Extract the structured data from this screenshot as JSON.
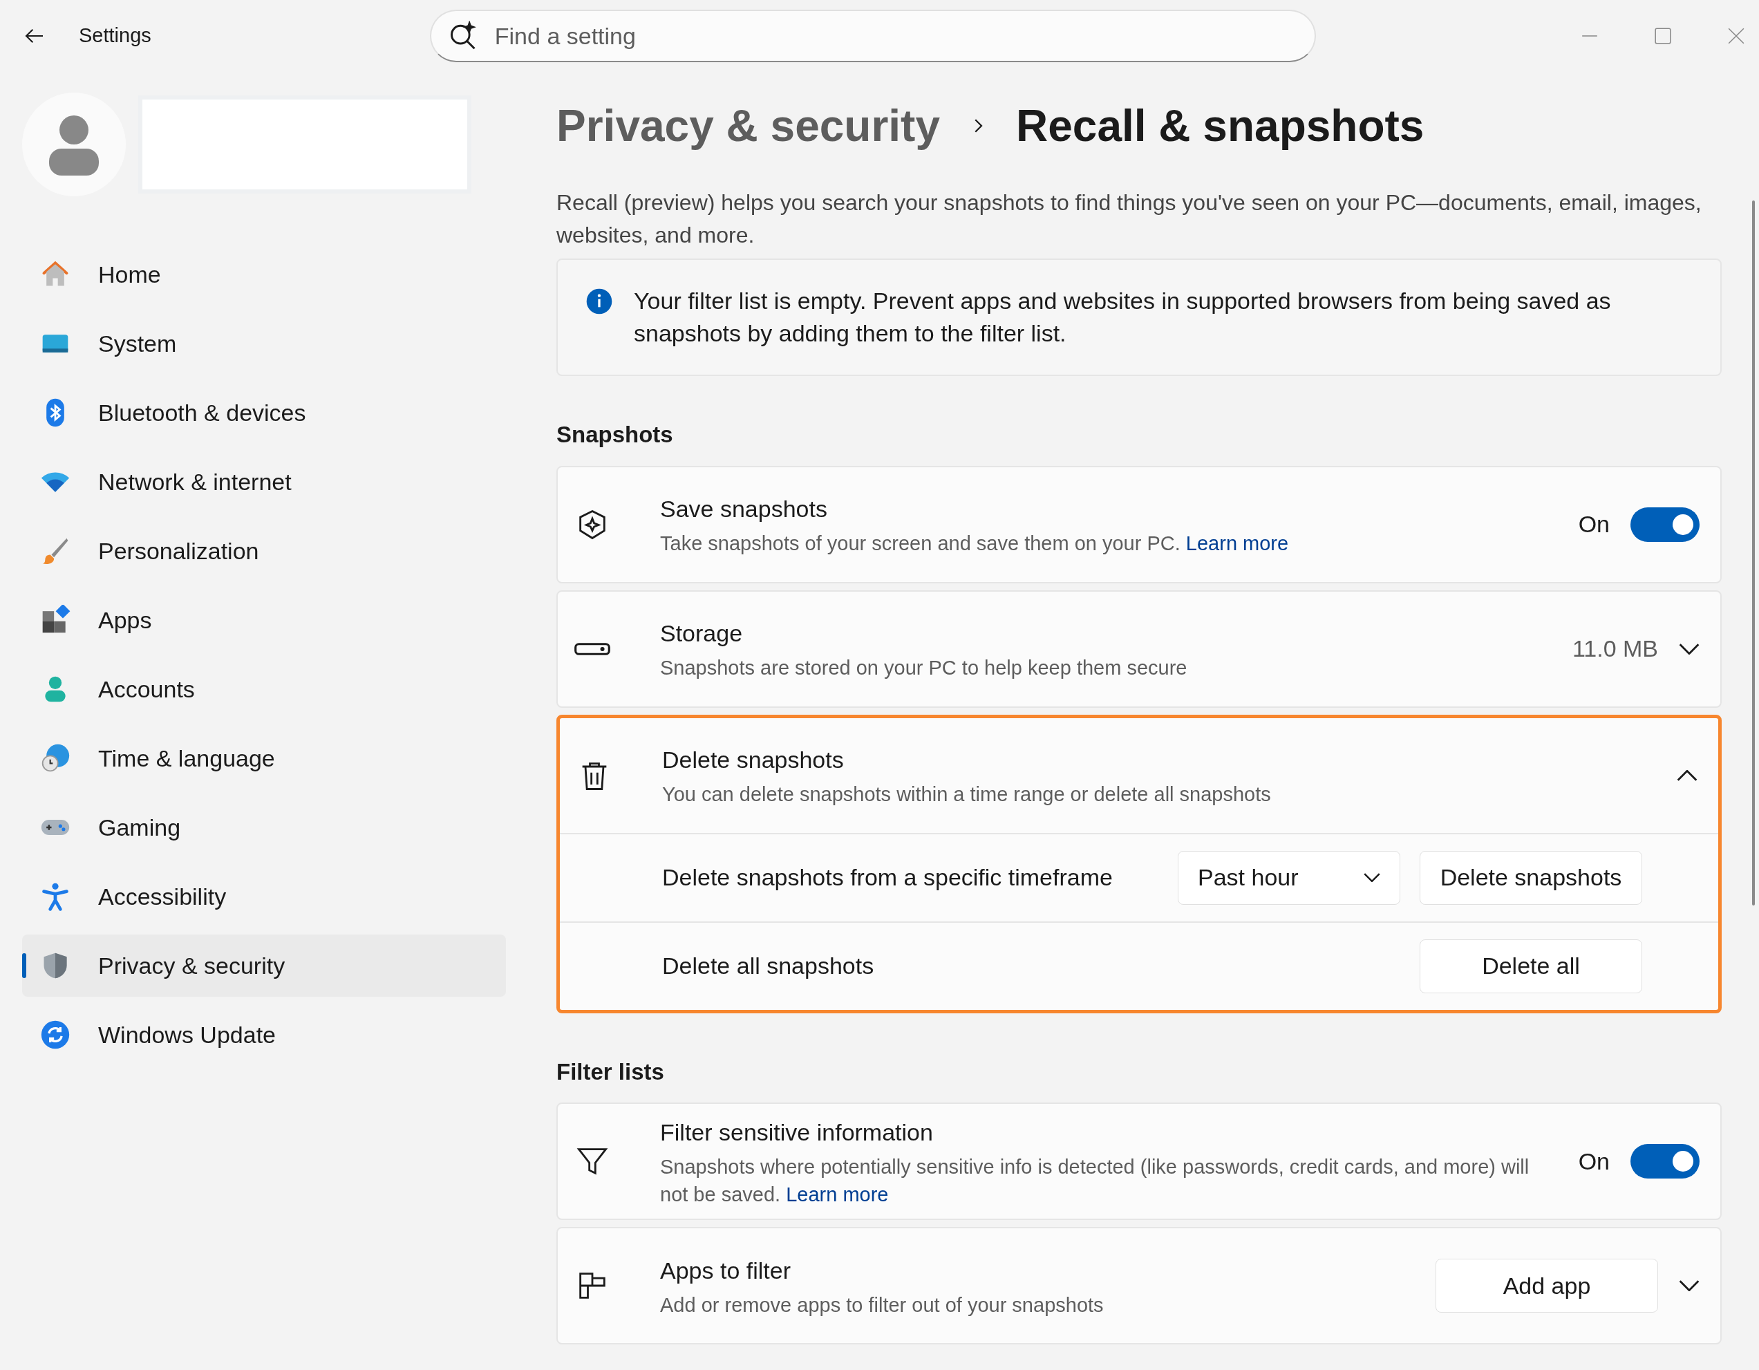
{
  "window": {
    "title": "Settings",
    "search_placeholder": "Find a setting"
  },
  "sidebar": {
    "items": [
      {
        "label": "Home",
        "selected": false
      },
      {
        "label": "System",
        "selected": false
      },
      {
        "label": "Bluetooth & devices",
        "selected": false
      },
      {
        "label": "Network & internet",
        "selected": false
      },
      {
        "label": "Personalization",
        "selected": false
      },
      {
        "label": "Apps",
        "selected": false
      },
      {
        "label": "Accounts",
        "selected": false
      },
      {
        "label": "Time & language",
        "selected": false
      },
      {
        "label": "Gaming",
        "selected": false
      },
      {
        "label": "Accessibility",
        "selected": false
      },
      {
        "label": "Privacy & security",
        "selected": true
      },
      {
        "label": "Windows Update",
        "selected": false
      }
    ]
  },
  "breadcrumb": [
    "Privacy & security",
    "Recall & snapshots"
  ],
  "description": "Recall (preview) helps you search your snapshots to find things you've seen on your PC—documents, email, images, websites, and more.",
  "info_banner": "Your filter list is empty. Prevent apps and websites in supported browsers from being saved as snapshots by adding them to the filter list.",
  "sections": [
    {
      "title": "Snapshots",
      "cards": [
        {
          "kind": "toggle",
          "title": "Save snapshots",
          "description": "Take snapshots of your screen and save them on your PC.",
          "link": "Learn more",
          "state_label": "On",
          "on": true,
          "highlighted": false
        },
        {
          "kind": "expander",
          "title": "Storage",
          "description": "Snapshots are stored on your PC to help keep them secure",
          "value": "11.0 MB",
          "expanded": false,
          "highlighted": false
        },
        {
          "kind": "expander",
          "title": "Delete snapshots",
          "description": "You can delete snapshots within a time range or delete all snapshots",
          "expanded": true,
          "highlighted": true,
          "rows": [
            {
              "label": "Delete snapshots from a specific timeframe",
              "dropdown": "Past hour",
              "button": "Delete snapshots"
            },
            {
              "label": "Delete all snapshots",
              "button": "Delete all"
            }
          ]
        }
      ]
    },
    {
      "title": "Filter lists",
      "cards": [
        {
          "kind": "toggle",
          "title": "Filter sensitive information",
          "description": "Snapshots where potentially sensitive info is detected (like passwords, credit cards, and more) will not be saved.",
          "link": "Learn more",
          "state_label": "On",
          "on": true,
          "highlighted": false
        },
        {
          "kind": "expander",
          "title": "Apps to filter",
          "description": "Add or remove apps to filter out of your snapshots",
          "button": "Add app",
          "expanded": false,
          "highlighted": false
        }
      ]
    }
  ]
}
